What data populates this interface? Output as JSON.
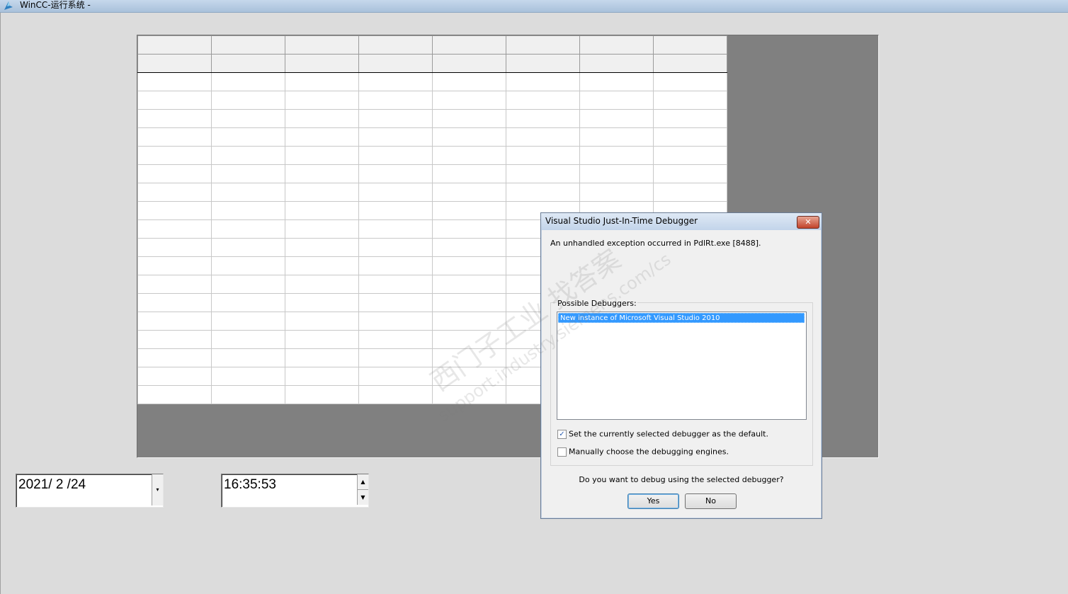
{
  "window": {
    "title": "WinCC-运行系统 -"
  },
  "table": {
    "columns": 8,
    "header_rows": 2,
    "data_rows": 18
  },
  "date_picker": {
    "value": "2021/ 2 /24",
    "dropdown_glyph": "▾"
  },
  "time_picker": {
    "value": "16:35:53",
    "up_glyph": "▲",
    "down_glyph": "▼"
  },
  "dialog": {
    "title": "Visual Studio Just-In-Time Debugger",
    "close_glyph": "✕",
    "message": "An unhandled exception occurred in PdlRt.exe [8488].",
    "group_label": "Possible Debuggers:",
    "debuggers": [
      "New instance of Microsoft Visual Studio 2010"
    ],
    "set_default_label": "Set the currently selected debugger as the default.",
    "set_default_checked": true,
    "manual_label": "Manually choose the debugging engines.",
    "manual_checked": false,
    "check_glyph": "✓",
    "question": "Do you want to debug using the selected debugger?",
    "yes_label": "Yes",
    "no_label": "No"
  },
  "watermark": {
    "line1": "西门子工业 找答案",
    "line2": "support.industry.siemens.com/cs"
  },
  "colors": {
    "table_background": "#808080",
    "selection": "#3399ff",
    "close_button": "#c2432b"
  }
}
